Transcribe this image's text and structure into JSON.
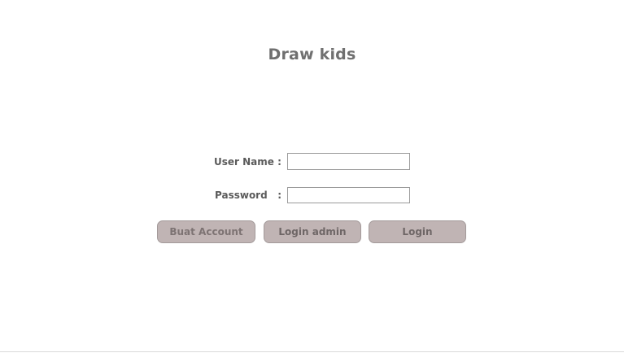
{
  "app": {
    "title": "Draw kids"
  },
  "form": {
    "username_label": "User Name :",
    "username_value": "",
    "password_label": "Password   :",
    "password_value": ""
  },
  "buttons": {
    "create_account": "Buat Account",
    "login_admin": "Login admin",
    "login": "Login"
  },
  "colors": {
    "button_bg": "#c0b4b4",
    "title_text": "#707070"
  }
}
